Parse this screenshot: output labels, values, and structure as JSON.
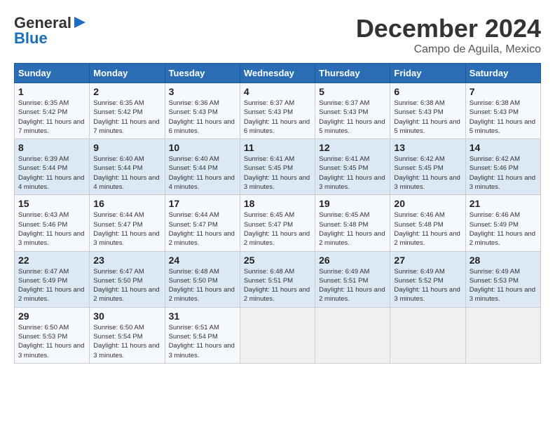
{
  "header": {
    "logo_line1": "General",
    "logo_line2": "Blue",
    "month": "December 2024",
    "location": "Campo de Aguila, Mexico"
  },
  "weekdays": [
    "Sunday",
    "Monday",
    "Tuesday",
    "Wednesday",
    "Thursday",
    "Friday",
    "Saturday"
  ],
  "weeks": [
    [
      {
        "day": "1",
        "info": "Sunrise: 6:35 AM\nSunset: 5:42 PM\nDaylight: 11 hours and 7 minutes."
      },
      {
        "day": "2",
        "info": "Sunrise: 6:35 AM\nSunset: 5:42 PM\nDaylight: 11 hours and 7 minutes."
      },
      {
        "day": "3",
        "info": "Sunrise: 6:36 AM\nSunset: 5:43 PM\nDaylight: 11 hours and 6 minutes."
      },
      {
        "day": "4",
        "info": "Sunrise: 6:37 AM\nSunset: 5:43 PM\nDaylight: 11 hours and 6 minutes."
      },
      {
        "day": "5",
        "info": "Sunrise: 6:37 AM\nSunset: 5:43 PM\nDaylight: 11 hours and 5 minutes."
      },
      {
        "day": "6",
        "info": "Sunrise: 6:38 AM\nSunset: 5:43 PM\nDaylight: 11 hours and 5 minutes."
      },
      {
        "day": "7",
        "info": "Sunrise: 6:38 AM\nSunset: 5:43 PM\nDaylight: 11 hours and 5 minutes."
      }
    ],
    [
      {
        "day": "8",
        "info": "Sunrise: 6:39 AM\nSunset: 5:44 PM\nDaylight: 11 hours and 4 minutes."
      },
      {
        "day": "9",
        "info": "Sunrise: 6:40 AM\nSunset: 5:44 PM\nDaylight: 11 hours and 4 minutes."
      },
      {
        "day": "10",
        "info": "Sunrise: 6:40 AM\nSunset: 5:44 PM\nDaylight: 11 hours and 4 minutes."
      },
      {
        "day": "11",
        "info": "Sunrise: 6:41 AM\nSunset: 5:45 PM\nDaylight: 11 hours and 3 minutes."
      },
      {
        "day": "12",
        "info": "Sunrise: 6:41 AM\nSunset: 5:45 PM\nDaylight: 11 hours and 3 minutes."
      },
      {
        "day": "13",
        "info": "Sunrise: 6:42 AM\nSunset: 5:45 PM\nDaylight: 11 hours and 3 minutes."
      },
      {
        "day": "14",
        "info": "Sunrise: 6:42 AM\nSunset: 5:46 PM\nDaylight: 11 hours and 3 minutes."
      }
    ],
    [
      {
        "day": "15",
        "info": "Sunrise: 6:43 AM\nSunset: 5:46 PM\nDaylight: 11 hours and 3 minutes."
      },
      {
        "day": "16",
        "info": "Sunrise: 6:44 AM\nSunset: 5:47 PM\nDaylight: 11 hours and 3 minutes."
      },
      {
        "day": "17",
        "info": "Sunrise: 6:44 AM\nSunset: 5:47 PM\nDaylight: 11 hours and 2 minutes."
      },
      {
        "day": "18",
        "info": "Sunrise: 6:45 AM\nSunset: 5:47 PM\nDaylight: 11 hours and 2 minutes."
      },
      {
        "day": "19",
        "info": "Sunrise: 6:45 AM\nSunset: 5:48 PM\nDaylight: 11 hours and 2 minutes."
      },
      {
        "day": "20",
        "info": "Sunrise: 6:46 AM\nSunset: 5:48 PM\nDaylight: 11 hours and 2 minutes."
      },
      {
        "day": "21",
        "info": "Sunrise: 6:46 AM\nSunset: 5:49 PM\nDaylight: 11 hours and 2 minutes."
      }
    ],
    [
      {
        "day": "22",
        "info": "Sunrise: 6:47 AM\nSunset: 5:49 PM\nDaylight: 11 hours and 2 minutes."
      },
      {
        "day": "23",
        "info": "Sunrise: 6:47 AM\nSunset: 5:50 PM\nDaylight: 11 hours and 2 minutes."
      },
      {
        "day": "24",
        "info": "Sunrise: 6:48 AM\nSunset: 5:50 PM\nDaylight: 11 hours and 2 minutes."
      },
      {
        "day": "25",
        "info": "Sunrise: 6:48 AM\nSunset: 5:51 PM\nDaylight: 11 hours and 2 minutes."
      },
      {
        "day": "26",
        "info": "Sunrise: 6:49 AM\nSunset: 5:51 PM\nDaylight: 11 hours and 2 minutes."
      },
      {
        "day": "27",
        "info": "Sunrise: 6:49 AM\nSunset: 5:52 PM\nDaylight: 11 hours and 3 minutes."
      },
      {
        "day": "28",
        "info": "Sunrise: 6:49 AM\nSunset: 5:53 PM\nDaylight: 11 hours and 3 minutes."
      }
    ],
    [
      {
        "day": "29",
        "info": "Sunrise: 6:50 AM\nSunset: 5:53 PM\nDaylight: 11 hours and 3 minutes."
      },
      {
        "day": "30",
        "info": "Sunrise: 6:50 AM\nSunset: 5:54 PM\nDaylight: 11 hours and 3 minutes."
      },
      {
        "day": "31",
        "info": "Sunrise: 6:51 AM\nSunset: 5:54 PM\nDaylight: 11 hours and 3 minutes."
      },
      {
        "day": "",
        "info": ""
      },
      {
        "day": "",
        "info": ""
      },
      {
        "day": "",
        "info": ""
      },
      {
        "day": "",
        "info": ""
      }
    ]
  ]
}
